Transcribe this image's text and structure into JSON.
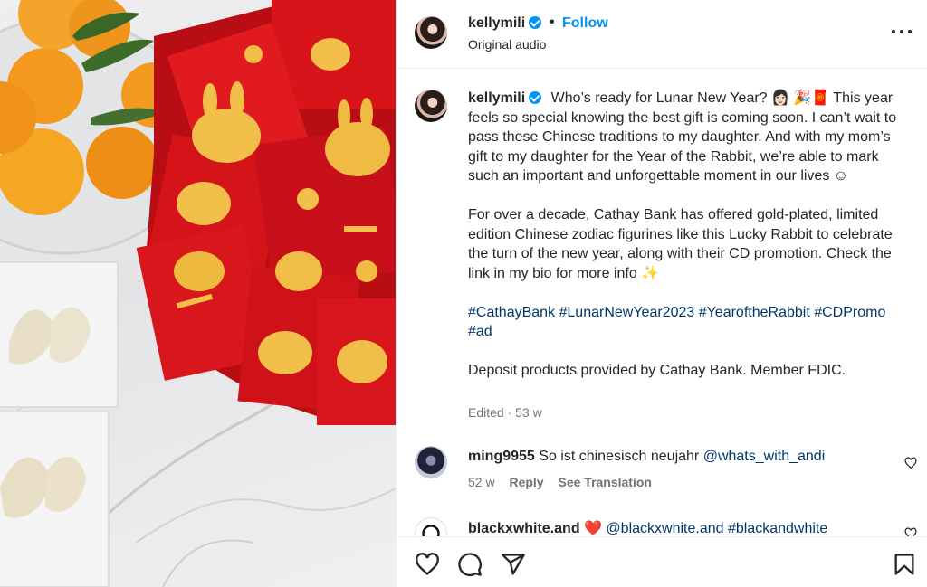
{
  "post": {
    "username": "kellymili",
    "follow_label": "Follow",
    "separator": "•",
    "audio": "Original audio",
    "caption": {
      "username": "kellymili",
      "text_1": "Who’s ready for Lunar New Year? 👩🏻 🎉🧧 This year feels so special knowing the best gift is coming soon. I can’t wait to pass these Chinese traditions to my daughter. And with my mom’s gift to my daughter for the Year of the Rabbit, we’re able to mark such an important and unforgettable moment in our lives ☺",
      "text_2": "For over a decade, Cathay Bank has offered gold-plated, limited edition Chinese zodiac figurines like this Lucky Rabbit to celebrate the turn of the new year, along with their CD promotion. Check the link in my bio for more info ✨",
      "hashtags": "#CathayBank #LunarNewYear2023 #YearoftheRabbit #CDPromo #ad",
      "text_3": "Deposit products provided by Cathay Bank. Member FDIC.",
      "meta": "Edited · 53 w"
    }
  },
  "comments": [
    {
      "username": "ming9955",
      "text": "So ist chinesisch neujahr",
      "mention": "@whats_with_andi",
      "age": "52 w",
      "reply_label": "Reply",
      "translate_label": "See Translation"
    },
    {
      "username": "blackxwhite.and",
      "emoji": "❤️",
      "text": "@blackxwhite.and #blackandwhite"
    }
  ],
  "icons": {
    "verified": "verified-badge-icon",
    "more": "more-options-icon",
    "like": "heart-icon",
    "comment": "comment-icon",
    "share": "share-icon",
    "save": "bookmark-icon"
  },
  "colors": {
    "link_blue": "#0095f6",
    "hashtag": "#00376b",
    "secondary_text": "#737373",
    "envelope_red": "#d7141a",
    "gold": "#f2c04a",
    "orange": "#f39a1e"
  }
}
